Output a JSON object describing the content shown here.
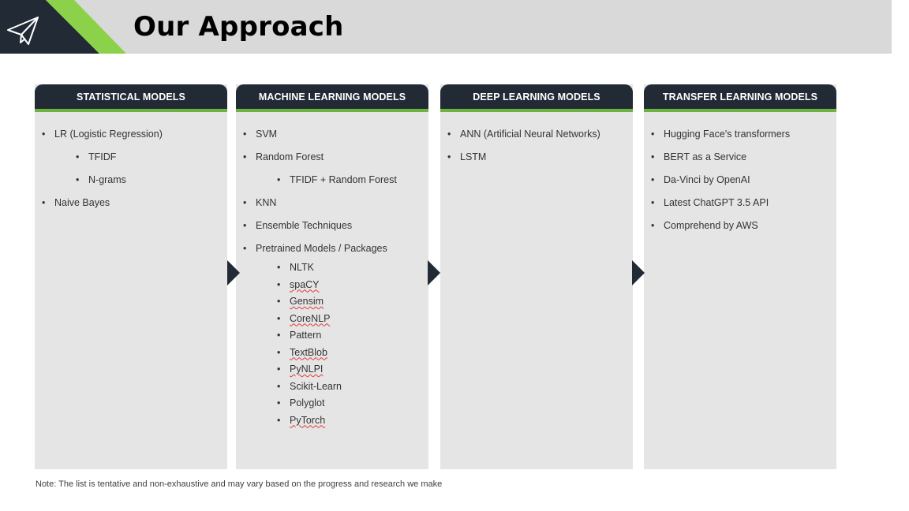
{
  "header": {
    "title": "Our Approach"
  },
  "columns": [
    {
      "title": "STATISTICAL MODELS",
      "items": [
        {
          "text": "LR (Logistic Regression)",
          "level": 1
        },
        {
          "text": "TFIDF",
          "level": 2
        },
        {
          "text": "N-grams",
          "level": 2
        },
        {
          "text": "Naive Bayes",
          "level": 1
        }
      ]
    },
    {
      "title": "MACHINE LEARNING MODELS",
      "items": [
        {
          "text": "SVM",
          "level": 1
        },
        {
          "text": "Random Forest",
          "level": 1
        },
        {
          "text": "TFIDF + Random Forest",
          "level": 2
        },
        {
          "text": "KNN",
          "level": 1
        },
        {
          "text": "Ensemble Techniques",
          "level": 1
        },
        {
          "text": "Pretrained Models / Packages",
          "level": 1
        },
        {
          "text": "NLTK",
          "level": 2
        },
        {
          "text": "spaCY",
          "level": 2
        },
        {
          "text": "Gensim",
          "level": 2
        },
        {
          "text": "CoreNLP",
          "level": 2
        },
        {
          "text": "Pattern",
          "level": 2
        },
        {
          "text": "TextBlob",
          "level": 2
        },
        {
          "text": "PyNLPI",
          "level": 2
        },
        {
          "text": "Scikit-Learn",
          "level": 2
        },
        {
          "text": "Polyglot",
          "level": 2
        },
        {
          "text": "PyTorch",
          "level": 2
        }
      ]
    },
    {
      "title": "DEEP LEARNING MODELS",
      "items": [
        {
          "text": "ANN (Artificial Neural Networks)",
          "level": 1
        },
        {
          "text": "LSTM",
          "level": 1
        }
      ]
    },
    {
      "title": "TRANSFER LEARNING MODELS",
      "items": [
        {
          "text": "Hugging Face's transformers",
          "level": 1
        },
        {
          "text": "BERT as a Service",
          "level": 1
        },
        {
          "text": "Da-Vinci by OpenAI",
          "level": 1
        },
        {
          "text": "Latest ChatGPT 3.5 API",
          "level": 1
        },
        {
          "text": "Comprehend by AWS",
          "level": 1
        }
      ]
    }
  ],
  "bullet": "•",
  "note": "Note: The list is tentative and non-exhaustive and may vary based on the progress and research we make",
  "colors": {
    "dark": "#222a35",
    "accent": "#6db33f",
    "panel": "#e5e5e5",
    "header_bg": "#d9d9d9"
  },
  "icons": {
    "logo": "paper-plane-icon",
    "step": "arrow-right-icon"
  }
}
